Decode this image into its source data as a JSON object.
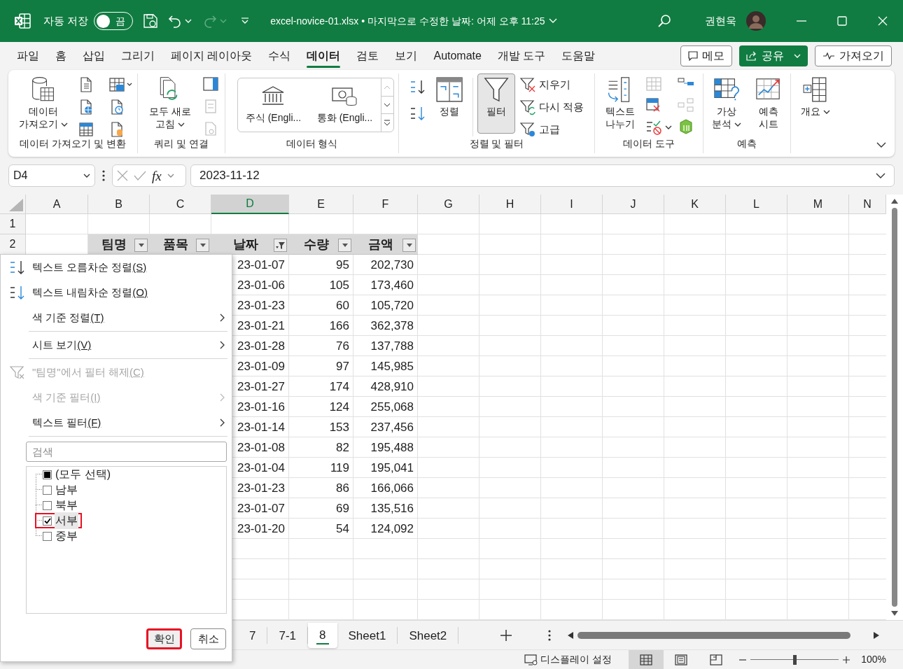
{
  "title_bar": {
    "autosave_label": "자동 저장",
    "autosave": {
      "on": false,
      "label": "끔"
    },
    "filename": "excel-novice-01.xlsx",
    "separator": "•",
    "saved_info": "마지막으로 수정한 날짜: 어제 오후 11:25",
    "user_name": "권현욱"
  },
  "menu_tabs": [
    {
      "label": "파일",
      "selected": false
    },
    {
      "label": "홈",
      "selected": false
    },
    {
      "label": "삽입",
      "selected": false
    },
    {
      "label": "그리기",
      "selected": false
    },
    {
      "label": "페이지 레이아웃",
      "selected": false
    },
    {
      "label": "수식",
      "selected": false
    },
    {
      "label": "데이터",
      "selected": true
    },
    {
      "label": "검토",
      "selected": false
    },
    {
      "label": "보기",
      "selected": false
    },
    {
      "label": "Automate",
      "selected": false
    },
    {
      "label": "개발 도구",
      "selected": false
    },
    {
      "label": "도움말",
      "selected": false
    }
  ],
  "header_buttons": [
    {
      "label": "메모",
      "kind": "outline"
    },
    {
      "label": "공유",
      "kind": "primary"
    },
    {
      "label": "가져오기",
      "kind": "outline"
    }
  ],
  "ribbon": {
    "groups": [
      {
        "label": "데이터 가져오기 및 변환",
        "buttons": [
          {
            "label": "데이터\n가져오기",
            "dropdown": true,
            "pressed": false
          }
        ]
      },
      {
        "label": "쿼리 및 연결",
        "buttons": [
          {
            "label": "모두 새로\n고침",
            "dropdown": true,
            "pressed": false
          }
        ]
      },
      {
        "label": "데이터 형식",
        "gallery": [
          "주식 (Engli...",
          "통화 (Engli..."
        ]
      },
      {
        "label": "정렬 및 필터",
        "buttons": [
          {
            "label": "정렬",
            "dropdown": false,
            "pressed": false
          },
          {
            "label": "필터",
            "dropdown": false,
            "pressed": true
          }
        ],
        "small_buttons": [
          "지우기",
          "다시 적용",
          "고급"
        ]
      },
      {
        "label": "데이터 도구",
        "buttons": [
          {
            "label": "텍스트\n나누기",
            "dropdown": false,
            "pressed": false
          }
        ]
      },
      {
        "label": "예측",
        "buttons": [
          {
            "label": "가상\n분석",
            "dropdown": true,
            "pressed": false
          },
          {
            "label": "예측\n시트",
            "dropdown": false,
            "pressed": false
          }
        ]
      },
      {
        "buttons": [
          {
            "label": "개요",
            "dropdown": true,
            "pressed": false
          }
        ]
      }
    ]
  },
  "formula_bar": {
    "name_box": "D4",
    "function_symbol": "fx",
    "value": "2023-11-12"
  },
  "sheet": {
    "columns": [
      {
        "label": "A",
        "selected": false
      },
      {
        "label": "B",
        "selected": false
      },
      {
        "label": "C",
        "selected": false
      },
      {
        "label": "D",
        "selected": true
      },
      {
        "label": "E",
        "selected": false
      },
      {
        "label": "F",
        "selected": false
      },
      {
        "label": "G",
        "selected": false
      },
      {
        "label": "H",
        "selected": false
      },
      {
        "label": "I",
        "selected": false
      },
      {
        "label": "J",
        "selected": false
      },
      {
        "label": "K",
        "selected": false
      },
      {
        "label": "L",
        "selected": false
      },
      {
        "label": "M",
        "selected": false
      },
      {
        "label": "N",
        "selected": false
      }
    ],
    "row_numbers": [
      "1",
      "2"
    ],
    "headers": [
      {
        "label": "팀명",
        "filtered": false
      },
      {
        "label": "품목",
        "filtered": false
      },
      {
        "label": "날짜",
        "filtered": true
      },
      {
        "label": "수량",
        "filtered": false
      },
      {
        "label": "금액",
        "filtered": false
      }
    ],
    "rows": [
      [
        "23-01-07",
        "95",
        "202,730"
      ],
      [
        "23-01-06",
        "105",
        "173,460"
      ],
      [
        "23-01-23",
        "60",
        "105,720"
      ],
      [
        "23-01-21",
        "166",
        "362,378"
      ],
      [
        "23-01-28",
        "76",
        "137,788"
      ],
      [
        "23-01-09",
        "97",
        "145,985"
      ],
      [
        "23-01-27",
        "174",
        "428,910"
      ],
      [
        "23-01-16",
        "124",
        "255,068"
      ],
      [
        "23-01-14",
        "153",
        "237,456"
      ],
      [
        "23-01-08",
        "82",
        "195,488"
      ],
      [
        "23-01-04",
        "119",
        "195,041"
      ],
      [
        "23-01-23",
        "86",
        "166,066"
      ],
      [
        "23-01-07",
        "69",
        "135,516"
      ],
      [
        "23-01-20",
        "54",
        "124,092"
      ]
    ]
  },
  "filter_menu": {
    "items": [
      {
        "kind": "sort-asc",
        "label": "텍스트 오름차순 정렬",
        "accel": "(S)",
        "disabled": false,
        "submenu": false
      },
      {
        "kind": "sort-desc",
        "label": "텍스트 내림차순 정렬",
        "accel": "(O)",
        "disabled": false,
        "submenu": false
      },
      {
        "kind": "command",
        "label": "색 기준 정렬",
        "accel": "(T)",
        "disabled": false,
        "submenu": true
      },
      {
        "kind": "separator"
      },
      {
        "kind": "command",
        "label": "시트 보기",
        "accel": "(V)",
        "disabled": false,
        "submenu": true
      },
      {
        "kind": "separator"
      },
      {
        "kind": "clear-filter",
        "label": "\"팀명\"에서 필터 해제",
        "accel": "(C)",
        "disabled": true,
        "submenu": false
      },
      {
        "kind": "command",
        "label": "색 기준 필터",
        "accel": "(I)",
        "disabled": true,
        "submenu": true
      },
      {
        "kind": "command",
        "label": "텍스트 필터",
        "accel": "(F)",
        "disabled": false,
        "submenu": true
      },
      {
        "kind": "separator"
      }
    ],
    "search": {
      "placeholder": "검색"
    },
    "values": [
      {
        "label": "(모두 선택)",
        "checked": false,
        "mixed": true,
        "highlighted": false
      },
      {
        "label": "남부",
        "checked": false,
        "mixed": false,
        "highlighted": false
      },
      {
        "label": "북부",
        "checked": false,
        "mixed": false,
        "highlighted": false
      },
      {
        "label": "서부",
        "checked": true,
        "mixed": false,
        "highlighted": true
      },
      {
        "label": "중부",
        "checked": false,
        "mixed": false,
        "highlighted": false
      }
    ],
    "buttons": [
      {
        "label": "확인",
        "highlighted": true
      },
      {
        "label": "취소",
        "highlighted": false
      }
    ]
  },
  "sheet_tabs": [
    {
      "label": "7",
      "selected": false
    },
    {
      "label": "7-1",
      "selected": false
    },
    {
      "label": "8",
      "selected": true
    },
    {
      "label": "Sheet1",
      "selected": false
    },
    {
      "label": "Sheet2",
      "selected": false
    }
  ],
  "status_bar": {
    "display_settings": "디스플레이 설정",
    "views": [
      {
        "kind": "normal",
        "selected": true
      },
      {
        "kind": "page-layout",
        "selected": false
      },
      {
        "kind": "page-break",
        "selected": false
      }
    ],
    "zoom": {
      "level": 0.5,
      "label": "100%"
    }
  }
}
